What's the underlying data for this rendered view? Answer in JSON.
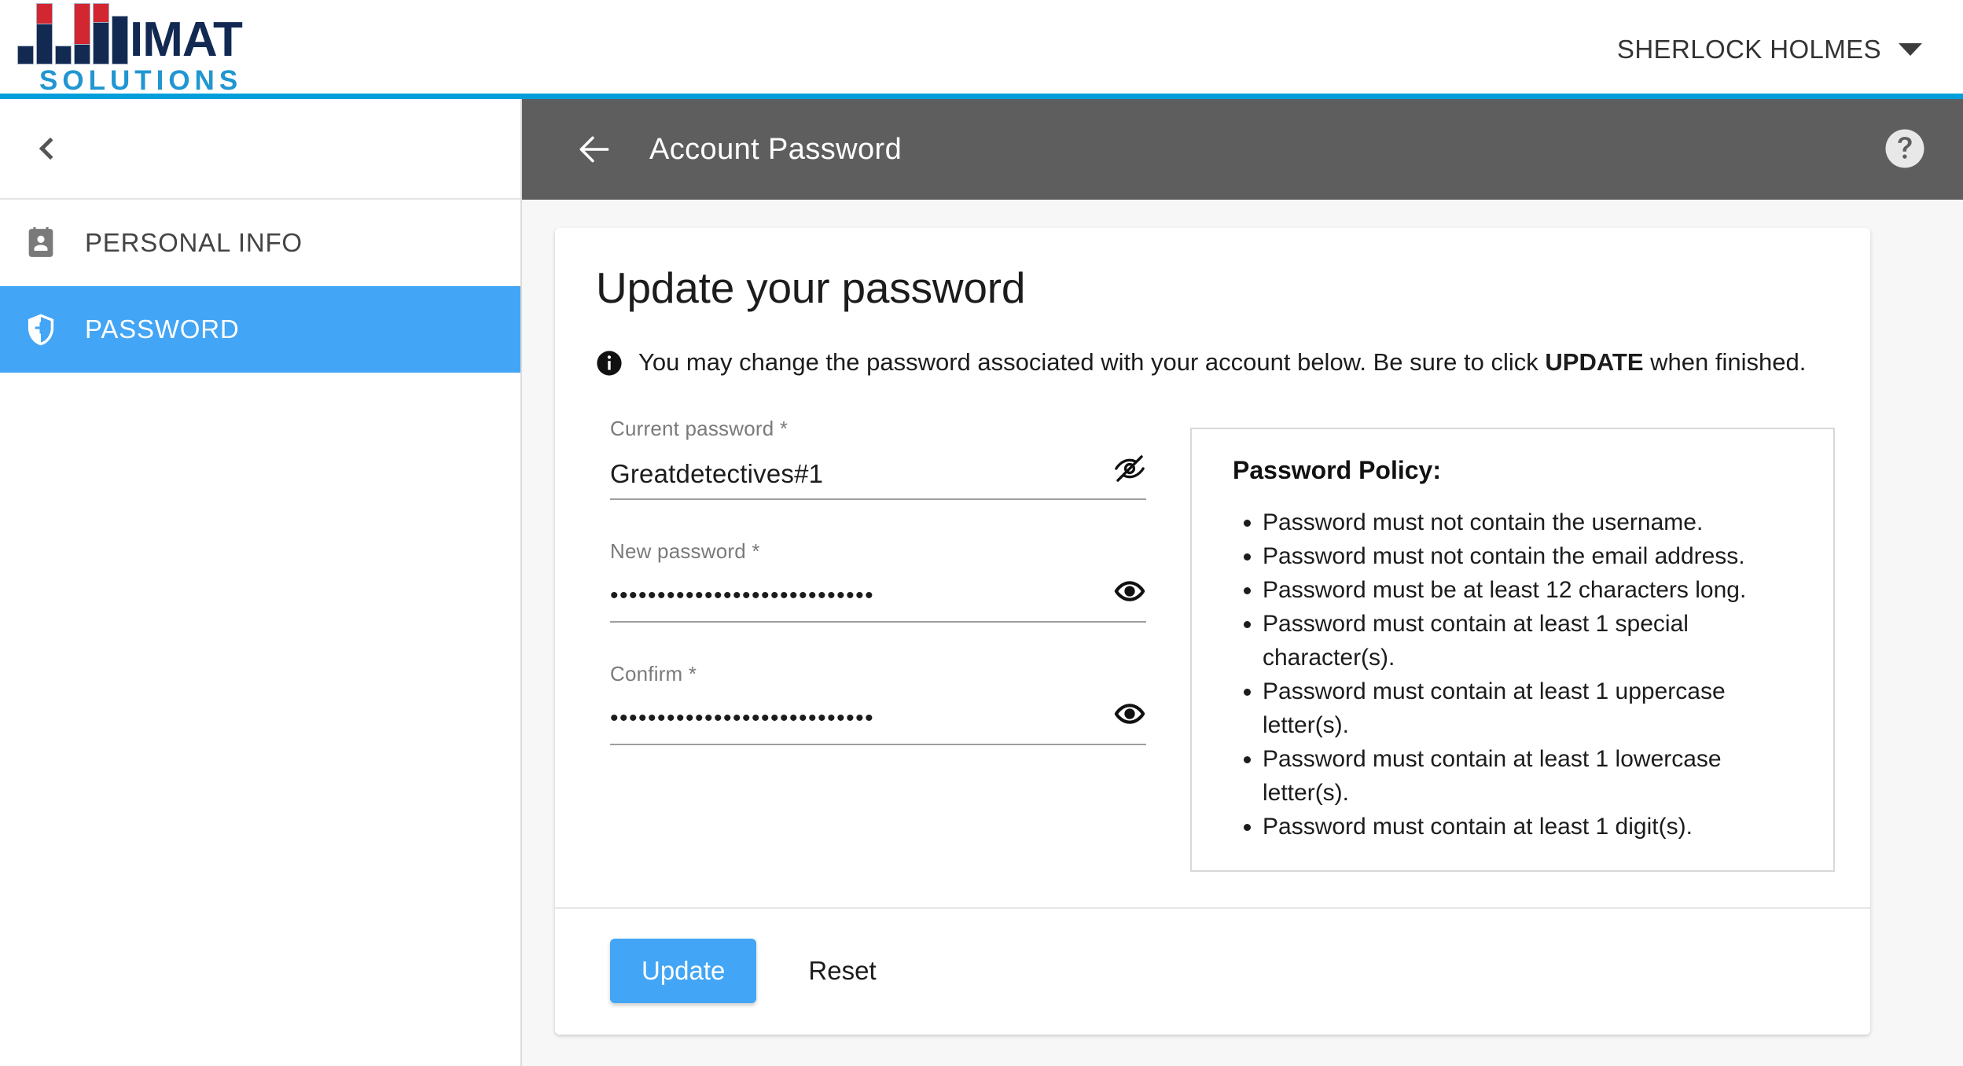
{
  "brand": {
    "name_main": "IMAT",
    "name_sub": "SOLUTIONS",
    "accent_color": "#009fdb",
    "navy": "#122a52",
    "red": "#d22630",
    "light_blue": "#2196d1"
  },
  "header": {
    "user_name": "SHERLOCK HOLMES",
    "caret_icon": "chevron-down-icon"
  },
  "sidebar": {
    "collapse_icon": "chevron-left-icon",
    "items": [
      {
        "label": "PERSONAL INFO",
        "icon": "contact-card-icon",
        "active": false
      },
      {
        "label": "PASSWORD",
        "icon": "shield-icon",
        "active": true
      }
    ]
  },
  "toolbar": {
    "back_icon": "arrow-left-icon",
    "title": "Account Password",
    "help_icon": "help-circle-icon",
    "background_color": "#5e5e5e"
  },
  "card": {
    "title": "Update your password",
    "info_icon": "info-icon",
    "info_text_before": "You may change the password associated with your account below. Be sure to click ",
    "info_text_bold": "UPDATE",
    "info_text_after": " when finished.",
    "fields": [
      {
        "label": "Current password *",
        "value": "Greatdetectives#1",
        "masked": false,
        "toggle_icon": "eye-off-icon",
        "placeholder": ""
      },
      {
        "label": "New password *",
        "value": "••••••••••••••••••••••••••••",
        "masked": true,
        "toggle_icon": "eye-icon",
        "placeholder": ""
      },
      {
        "label": "Confirm *",
        "value": "••••••••••••••••••••••••••••",
        "masked": true,
        "toggle_icon": "eye-icon",
        "placeholder": ""
      }
    ],
    "policy": {
      "title": "Password Policy:",
      "rules": [
        "Password must not contain the username.",
        "Password must not contain the email address.",
        "Password must be at least 12 characters long.",
        "Password must contain at least 1 special character(s).",
        "Password must contain at least 1 uppercase letter(s).",
        "Password must contain at least 1 lowercase letter(s).",
        "Password must contain at least 1 digit(s)."
      ]
    },
    "buttons": {
      "update_label": "Update",
      "update_color": "#42a5f5",
      "reset_label": "Reset"
    }
  }
}
